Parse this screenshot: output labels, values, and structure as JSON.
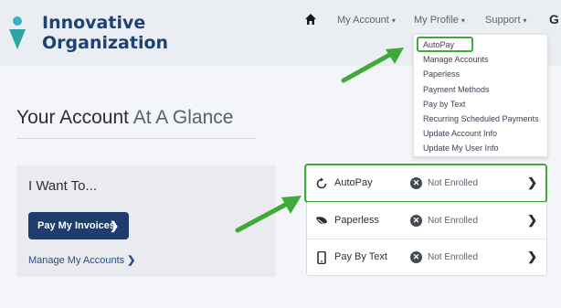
{
  "brand": {
    "line1": "Innovative",
    "line2": "Organization",
    "logo_icon": "person-mark-icon",
    "mark_top_color": "#3ab0c8",
    "mark_bottom_color": "#2aa7a5",
    "text_color": "#1e4270"
  },
  "nav": {
    "home_icon": "home-icon",
    "items": [
      {
        "label": "My Account"
      },
      {
        "label": "My Profile"
      },
      {
        "label": "Support"
      }
    ],
    "cutoff_glyph": "G"
  },
  "profile_menu": {
    "items": [
      "AutoPay",
      "Manage Accounts",
      "Paperless",
      "Payment Methods",
      "Pay by Text",
      "Recurring Scheduled Payments",
      "Update Account Info",
      "Update My User Info"
    ],
    "highlighted": "AutoPay"
  },
  "page": {
    "title_main": "Your Account",
    "title_light": "At A Glance"
  },
  "want": {
    "heading": "I Want To...",
    "pay_button": "Pay My Invoices",
    "manage_link": "Manage My Accounts"
  },
  "enrollment": {
    "rows": [
      {
        "label": "AutoPay",
        "icon": "refresh-icon",
        "status": "Not Enrolled"
      },
      {
        "label": "Paperless",
        "icon": "leaf-icon",
        "status": "Not Enrolled"
      },
      {
        "label": "Pay By Text",
        "icon": "phone-icon",
        "status": "Not Enrolled"
      }
    ]
  },
  "colors": {
    "highlight": "#3eaa39",
    "button": "#1f3d6c",
    "link": "#2c4d86"
  }
}
